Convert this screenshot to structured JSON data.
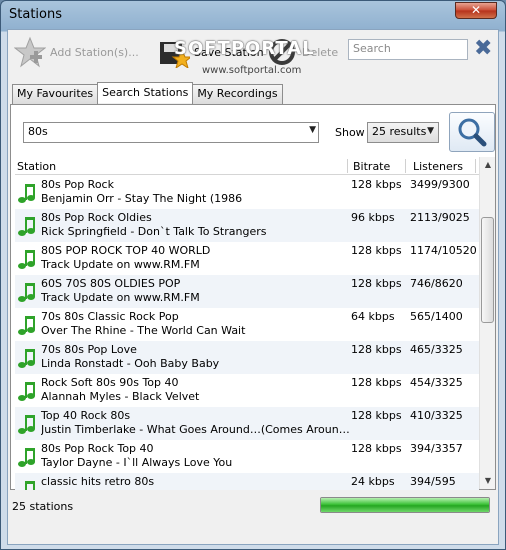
{
  "window": {
    "title": "Stations",
    "close_glyph": "✕"
  },
  "toolbar": {
    "add_label": "Add Station(s)...",
    "save_label": "Save Station",
    "delete_label": "Delete",
    "search_placeholder": "Search",
    "clear_glyph": "✖"
  },
  "watermark": {
    "text": "SOFTPORTAL",
    "url": "www.softportal.com"
  },
  "tabs": [
    {
      "label": "My Favourites",
      "active": false
    },
    {
      "label": "Search Stations",
      "active": true
    },
    {
      "label": "My Recordings",
      "active": false
    }
  ],
  "search": {
    "query": "80s",
    "show_label": "Show",
    "results_option": "25 results"
  },
  "list": {
    "columns": {
      "station": "Station",
      "bitrate": "Bitrate",
      "listeners": "Listeners"
    },
    "rows": [
      {
        "name": "80s Pop Rock",
        "track": "Benjamin Orr - Stay The Night (1986",
        "bitrate": "128 kbps",
        "listeners": "3499/9300"
      },
      {
        "name": "80s Pop Rock Oldies",
        "track": "Rick Springfield - Don`t Talk To Strangers",
        "bitrate": "96 kbps",
        "listeners": "2113/9025"
      },
      {
        "name": "80S POP ROCK TOP 40 WORLD",
        "track": "Track Update on www.RM.FM",
        "bitrate": "128 kbps",
        "listeners": "1174/10520"
      },
      {
        "name": "60S 70S 80S OLDIES POP",
        "track": "Track Update on www.RM.FM",
        "bitrate": "128 kbps",
        "listeners": "746/8620"
      },
      {
        "name": "70s 80s Classic Rock Pop",
        "track": "Over The Rhine - The World Can Wait",
        "bitrate": "64 kbps",
        "listeners": "565/1400"
      },
      {
        "name": "70s  80s  Pop  Love",
        "track": "Linda Ronstadt - Ooh Baby Baby",
        "bitrate": "128 kbps",
        "listeners": "465/3325"
      },
      {
        "name": "Rock Soft 80s 90s Top 40",
        "track": "Alannah Myles - Black Velvet",
        "bitrate": "128 kbps",
        "listeners": "454/3325"
      },
      {
        "name": "Top 40 Rock 80s",
        "track": "Justin Timberlake - What Goes Around…(Comes Around) (R…",
        "bitrate": "128 kbps",
        "listeners": "410/3325"
      },
      {
        "name": "80s Pop Rock Top 40",
        "track": "Taylor Dayne - I`ll Always Love You",
        "bitrate": "128 kbps",
        "listeners": "394/3357"
      },
      {
        "name": "classic hits retro 80s",
        "track": "",
        "bitrate": "24 kbps",
        "listeners": "394/595"
      }
    ]
  },
  "status": {
    "text": "25 stations",
    "progress": 1.0
  },
  "colors": {
    "note": "#2fa32a",
    "progress": "#32b52e"
  }
}
